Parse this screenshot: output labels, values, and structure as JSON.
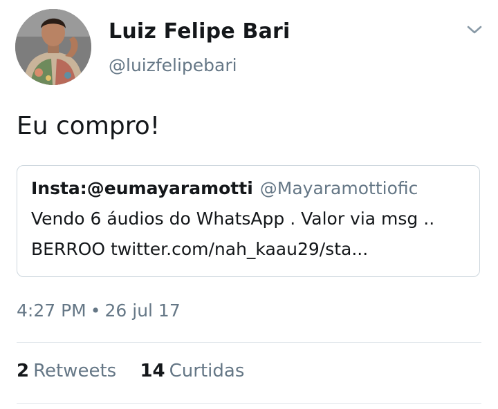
{
  "tweet": {
    "author": {
      "display_name": "Luiz Felipe Bari",
      "handle": "@luizfelipebari"
    },
    "text": "Eu compro!",
    "quoted": {
      "name": "Insta:@eumayaramotti",
      "handle": "@Mayaramottiofic",
      "line1": "Vendo 6 áudios do WhatsApp . Valor via msg ..",
      "line2": "BERROO twitter.com/nah_kaau29/sta..."
    },
    "time": "4:27 PM",
    "separator": "•",
    "date": "26 jul 17",
    "stats": {
      "retweets_count": "2",
      "retweets_label": "Retweets",
      "likes_count": "14",
      "likes_label": "Curtidas"
    }
  },
  "colors": {
    "text_primary": "#14171a",
    "text_secondary": "#657786",
    "border": "#ccd6dd"
  },
  "icons": {
    "menu": "chevron-down-icon"
  }
}
